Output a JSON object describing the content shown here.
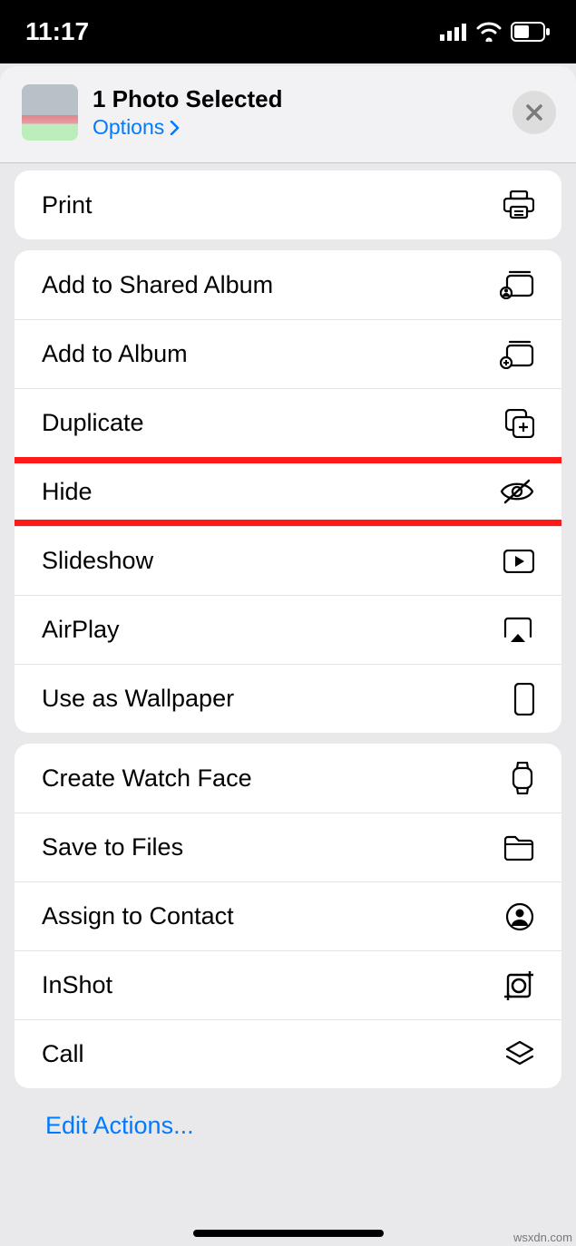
{
  "status": {
    "time": "11:17"
  },
  "sheet": {
    "title": "1 Photo Selected",
    "options_label": "Options"
  },
  "section1": {
    "print": "Print"
  },
  "section2": {
    "add_shared": "Add to Shared Album",
    "add_album": "Add to Album",
    "duplicate": "Duplicate",
    "hide": "Hide",
    "slideshow": "Slideshow",
    "airplay": "AirPlay",
    "wallpaper": "Use as Wallpaper"
  },
  "section3": {
    "watch": "Create Watch Face",
    "files": "Save to Files",
    "contact": "Assign to Contact",
    "inshot": "InShot",
    "call": "Call"
  },
  "footer": {
    "edit": "Edit Actions..."
  },
  "watermark": "wsxdn.com"
}
